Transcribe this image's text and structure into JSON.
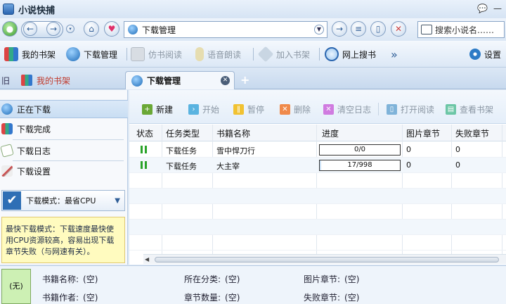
{
  "app": {
    "title": "小说快捕",
    "help_icon": "help-icon",
    "minimize_glyph": "—"
  },
  "nav": {
    "address_text": "下载管理",
    "search_placeholder": "搜索小说名……"
  },
  "toolbar": {
    "items": [
      {
        "label": "我的书架",
        "icon": "books-icon",
        "enabled": true
      },
      {
        "label": "下载管理",
        "icon": "globe-icon",
        "enabled": true
      },
      {
        "label": "仿书阅读",
        "icon": "book-icon",
        "enabled": false
      },
      {
        "label": "语音朗读",
        "icon": "microphone-icon",
        "enabled": false
      },
      {
        "label": "加入书架",
        "icon": "add-bookshelf-icon",
        "enabled": false
      },
      {
        "label": "网上搜书",
        "icon": "search-globe-icon",
        "enabled": true
      }
    ],
    "more_glyph": "»",
    "settings_label": "设置"
  },
  "tabs": {
    "side_label": "旧",
    "items": [
      {
        "label": "我的书架",
        "active": false
      },
      {
        "label": "下载管理",
        "active": true
      }
    ],
    "add_glyph": "+"
  },
  "left": {
    "items": [
      {
        "label": "正在下载",
        "selected": true
      },
      {
        "label": "下载完成",
        "selected": false
      },
      {
        "label": "下载日志",
        "selected": false
      },
      {
        "label": "下载设置",
        "selected": false
      }
    ],
    "mode_label": "下载模式：最省CPU",
    "note": "最快下载模式：下载速度最快使用CPU资源较高，容易出现下载章节失败（与网速有关）。"
  },
  "right_toolbar": {
    "items": [
      {
        "label": "新建",
        "enabled": true,
        "color": "#6aa836"
      },
      {
        "label": "开始",
        "enabled": false,
        "color": "#5ab3e0"
      },
      {
        "label": "暂停",
        "enabled": false,
        "color": "#f1c232"
      },
      {
        "label": "删除",
        "enabled": false,
        "color": "#f08a4b"
      },
      {
        "label": "清空日志",
        "enabled": false,
        "color": "#d07be0"
      },
      {
        "label": "打开阅读",
        "enabled": false,
        "color": "#7fb3d9"
      },
      {
        "label": "查看书架",
        "enabled": false,
        "color": "#6cc6a6"
      }
    ]
  },
  "grid": {
    "headers": [
      "状态",
      "任务类型",
      "书籍名称",
      "进度",
      "图片章节",
      "失败章节"
    ],
    "rows": [
      {
        "task_type": "下载任务",
        "book": "雪中悍刀行",
        "progress": "0/0",
        "fraction": 0,
        "image_chapters": "0",
        "failed_chapters": "0"
      },
      {
        "task_type": "下载任务",
        "book": "大主宰",
        "progress": "17/998",
        "fraction": 0.017,
        "image_chapters": "0",
        "failed_chapters": "0"
      }
    ]
  },
  "bottom": {
    "cover_text": "(无)",
    "fields": [
      {
        "label": "书籍名称:",
        "value": "(空)"
      },
      {
        "label": "书籍作者:",
        "value": "(空)"
      },
      {
        "label": "所在分类:",
        "value": "(空)"
      },
      {
        "label": "章节数量:",
        "value": "(空)"
      },
      {
        "label": "图片章节:",
        "value": "(空)"
      },
      {
        "label": "失败章节:",
        "value": "(空)"
      }
    ]
  }
}
